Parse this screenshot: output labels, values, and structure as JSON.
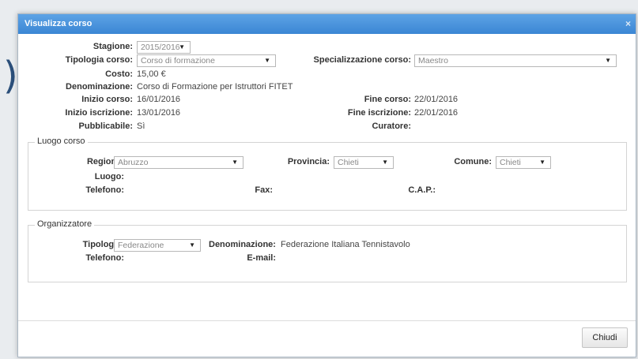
{
  "window": {
    "title": "Visualizza corso",
    "close_glyph": "×"
  },
  "background": {
    "glyph": ")"
  },
  "course": {
    "stagione_label": "Stagione:",
    "stagione_value": "2015/2016",
    "tipologia_label": "Tipologia corso:",
    "tipologia_value": "Corso di formazione",
    "specializzazione_label": "Specializzazione corso:",
    "specializzazione_value": "Maestro",
    "costo_label": "Costo:",
    "costo_value": "15,00 €",
    "denominazione_label": "Denominazione:",
    "denominazione_value": "Corso di Formazione per Istruttori FITET",
    "inizio_corso_label": "Inizio corso:",
    "inizio_corso_value": "16/01/2016",
    "fine_corso_label": "Fine corso:",
    "fine_corso_value": "22/01/2016",
    "inizio_iscrizione_label": "Inizio iscrizione:",
    "inizio_iscrizione_value": "13/01/2016",
    "fine_iscrizione_label": "Fine iscrizione:",
    "fine_iscrizione_value": "22/01/2016",
    "pubblicabile_label": "Pubblicabile:",
    "pubblicabile_value": "Sì",
    "curatore_label": "Curatore:",
    "curatore_value": ""
  },
  "luogo": {
    "legend": "Luogo corso",
    "regione_label": "Regione:",
    "regione_value": "Abruzzo",
    "provincia_label": "Provincia:",
    "provincia_value": "Chieti",
    "comune_label": "Comune:",
    "comune_value": "Chieti",
    "luogo_label": "Luogo:",
    "telefono_label": "Telefono:",
    "fax_label": "Fax:",
    "cap_label": "C.A.P.:"
  },
  "organizzatore": {
    "legend": "Organizzatore",
    "tipologia_label": "Tipologia:",
    "tipologia_value": "Federazione",
    "denominazione_label": "Denominazione:",
    "denominazione_value": "Federazione Italiana Tennistavolo",
    "telefono_label": "Telefono:",
    "email_label": "E-mail:"
  },
  "footer": {
    "close_button": "Chiudi"
  },
  "icons": {
    "dropdown": "▼"
  },
  "colors": {
    "titlebar": "#3b86d4",
    "border": "#aab7c4"
  }
}
